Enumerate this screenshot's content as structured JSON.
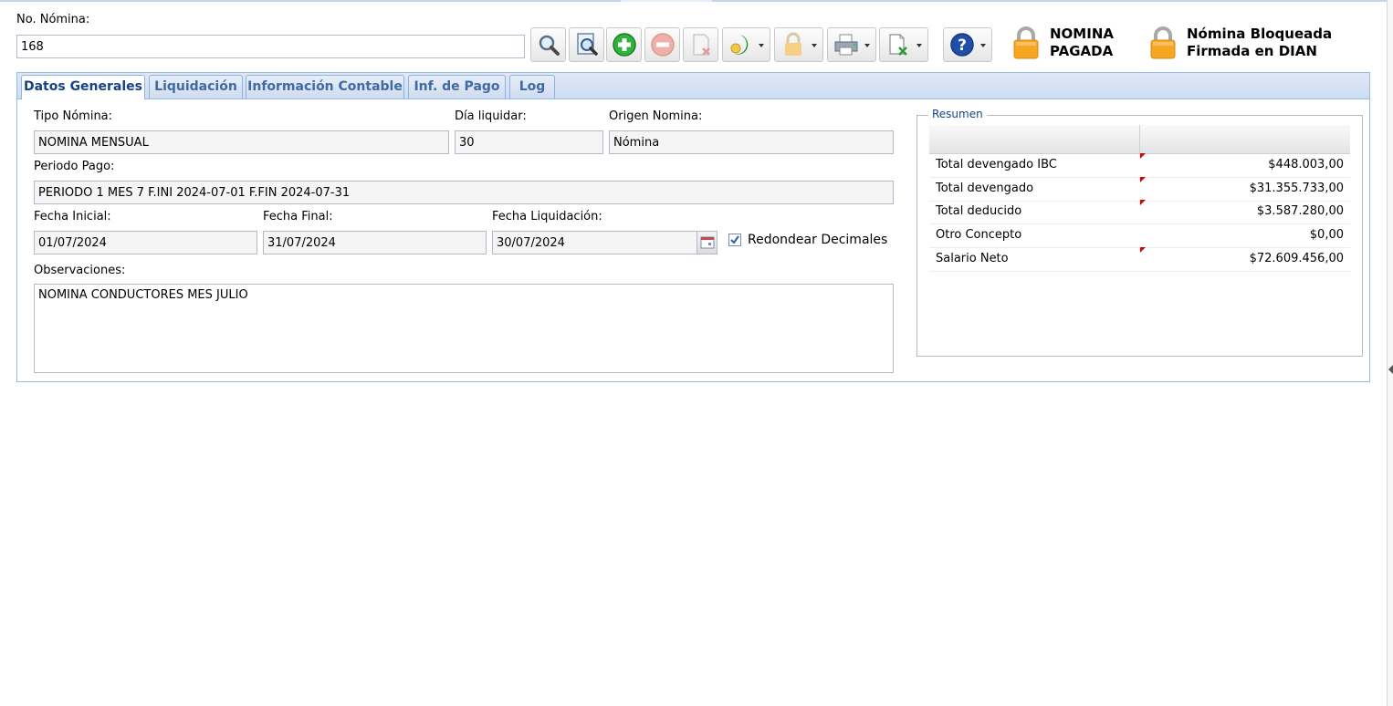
{
  "header": {
    "nomina_label": "No. Nómina:",
    "nomina_value": "168"
  },
  "toolbar": {
    "buttons": [
      {
        "name": "search",
        "icon": "magnifier-icon"
      },
      {
        "name": "advanced-search",
        "icon": "document-search-icon"
      },
      {
        "name": "add",
        "icon": "plus-circle-icon"
      },
      {
        "name": "remove",
        "icon": "minus-circle-icon"
      },
      {
        "name": "delete",
        "icon": "page-delete-icon"
      },
      {
        "name": "process",
        "icon": "moon-gear-icon"
      },
      {
        "name": "lock",
        "icon": "lock-icon"
      },
      {
        "name": "print",
        "icon": "printer-icon"
      },
      {
        "name": "export",
        "icon": "excel-export-icon"
      },
      {
        "name": "help",
        "icon": "help-icon"
      }
    ]
  },
  "badges": {
    "pagada": "NOMINA\nPAGADA",
    "dian": "Nómina Bloqueada\nFirmada en DIAN",
    "lock_color": "#f5a623"
  },
  "tabs": [
    {
      "label": "Datos Generales",
      "active": true
    },
    {
      "label": "Liquidación"
    },
    {
      "label": "Información Contable"
    },
    {
      "label": "Inf. de Pago"
    },
    {
      "label": "Log"
    }
  ],
  "form": {
    "tipo_label": "Tipo Nómina:",
    "tipo_value": "NOMINA MENSUAL",
    "dia_label": "Día liquidar:",
    "dia_value": "30",
    "origen_label": "Origen Nomina:",
    "origen_value": "Nómina",
    "periodo_label": "Periodo Pago:",
    "periodo_value": "PERIODO 1 MES 7 F.INI 2024-07-01 F.FIN 2024-07-31",
    "fecha_ini_label": "Fecha Inicial:",
    "fecha_ini_value": "01/07/2024",
    "fecha_fin_label": "Fecha Final:",
    "fecha_fin_value": "31/07/2024",
    "fecha_liq_label": "Fecha Liquidación:",
    "fecha_liq_value": "30/07/2024",
    "redondear_label": "Redondear Decimales",
    "redondear_checked": true,
    "obs_label": "Observaciones:",
    "obs_value": "NOMINA CONDUCTORES MES JULIO"
  },
  "resumen": {
    "legend": "Resumen",
    "rows": [
      {
        "concepto": "Total devengado IBC",
        "valor": "$448.003,00",
        "dirty": true
      },
      {
        "concepto": "Total devengado",
        "valor": "$31.355.733,00",
        "dirty": true
      },
      {
        "concepto": "Total deducido",
        "valor": "$3.587.280,00",
        "dirty": true
      },
      {
        "concepto": "Otro Concepto",
        "valor": "$0,00",
        "dirty": false
      },
      {
        "concepto": "Salario Neto",
        "valor": "$72.609.456,00",
        "dirty": true
      }
    ]
  }
}
